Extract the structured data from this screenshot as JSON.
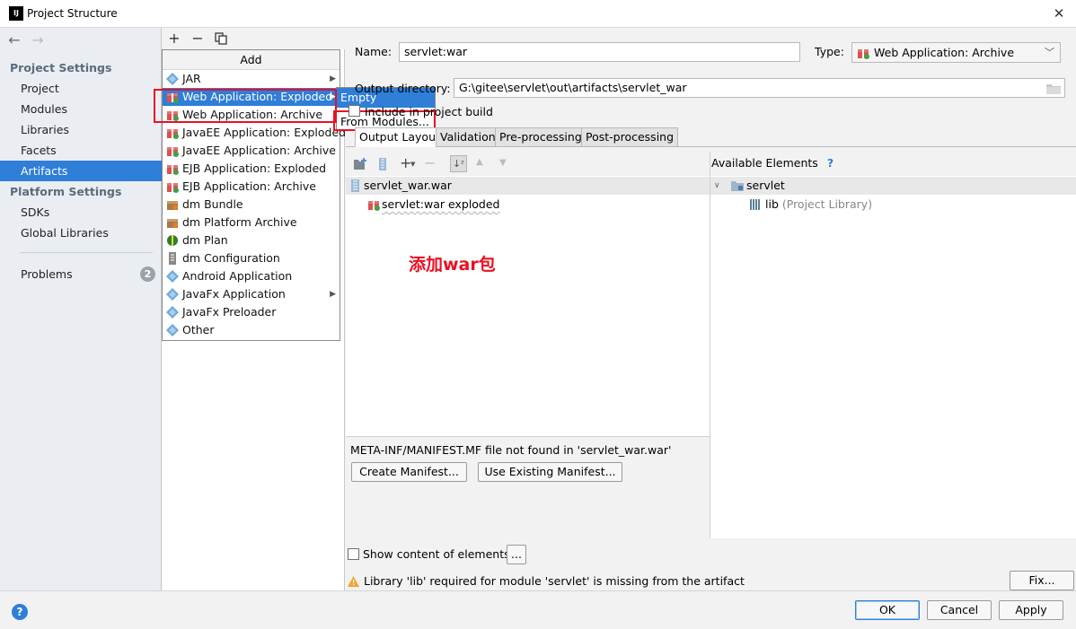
{
  "window": {
    "title": "Project Structure",
    "app_icon_text": "IJ"
  },
  "sidebar": {
    "project_settings_header": "Project Settings",
    "platform_settings_header": "Platform Settings",
    "items": [
      "Project",
      "Modules",
      "Libraries",
      "Facets",
      "Artifacts"
    ],
    "platform_items": [
      "SDKs",
      "Global Libraries"
    ],
    "selected": "Artifacts",
    "problems_label": "Problems",
    "problems_count": "2"
  },
  "toolbar": {
    "add": "+",
    "remove": "−"
  },
  "add_menu": {
    "header": "Add",
    "items": [
      {
        "label": "JAR",
        "icon": "diamond-icon",
        "submenu": true
      },
      {
        "label": "Web Application: Exploded",
        "icon": "gift-icon",
        "submenu": true,
        "highlighted": true
      },
      {
        "label": "Web Application: Archive",
        "icon": "gift-icon"
      },
      {
        "label": "JavaEE Application: Exploded",
        "icon": "gift-icon"
      },
      {
        "label": "JavaEE Application: Archive",
        "icon": "gift-icon"
      },
      {
        "label": "EJB Application: Exploded",
        "icon": "gift-icon"
      },
      {
        "label": "EJB Application: Archive",
        "icon": "gift-icon"
      },
      {
        "label": "dm Bundle",
        "icon": "bundle-icon"
      },
      {
        "label": "dm Platform Archive",
        "icon": "bundle-icon"
      },
      {
        "label": "dm Plan",
        "icon": "leaf-icon"
      },
      {
        "label": "dm Configuration",
        "icon": "config-icon"
      },
      {
        "label": "Android Application",
        "icon": "diamond-icon"
      },
      {
        "label": "JavaFx Application",
        "icon": "diamond-icon",
        "submenu": true
      },
      {
        "label": "JavaFx Preloader",
        "icon": "diamond-icon"
      },
      {
        "label": "Other",
        "icon": "diamond-icon"
      }
    ]
  },
  "submenu": {
    "items": [
      "Empty",
      "From Modules..."
    ],
    "highlighted": "Empty"
  },
  "form": {
    "name_label": "Name:",
    "name_value": "servlet:war",
    "type_label": "Type:",
    "type_value": "Web Application: Archive",
    "output_dir_label": "Output directory:",
    "output_dir_value": "G:\\gitee\\servlet\\out\\artifacts\\servlet_war",
    "include_build_label": "Include in project build"
  },
  "tabs": [
    "Output Layout",
    "Validation",
    "Pre-processing",
    "Post-processing"
  ],
  "active_tab": "Output Layout",
  "layout_tree": [
    {
      "label": "servlet_war.war",
      "icon": "archive-icon",
      "selected": true
    },
    {
      "label": "servlet:war exploded",
      "icon": "gift-icon"
    }
  ],
  "available": {
    "header": "Available Elements",
    "help": "?",
    "tree": [
      {
        "label": "servlet",
        "icon": "folder-icon"
      },
      {
        "label": "lib",
        "suffix": "(Project Library)",
        "icon": "library-icon"
      }
    ]
  },
  "manifest": {
    "message": "META-INF/MANIFEST.MF file not found in 'servlet_war.war'",
    "create_button": "Create Manifest...",
    "use_existing_button": "Use Existing Manifest..."
  },
  "show_content_label": "Show content of elements",
  "ellipsis_button": "...",
  "warning": "Library 'lib' required for module 'servlet' is missing from the artifact",
  "fix_button": "Fix...",
  "annotation": "添加war包",
  "buttons": {
    "ok": "OK",
    "cancel": "Cancel",
    "apply": "Apply"
  },
  "colors": {
    "selection": "#2f7ed8",
    "highlight_box": "#e81123"
  }
}
